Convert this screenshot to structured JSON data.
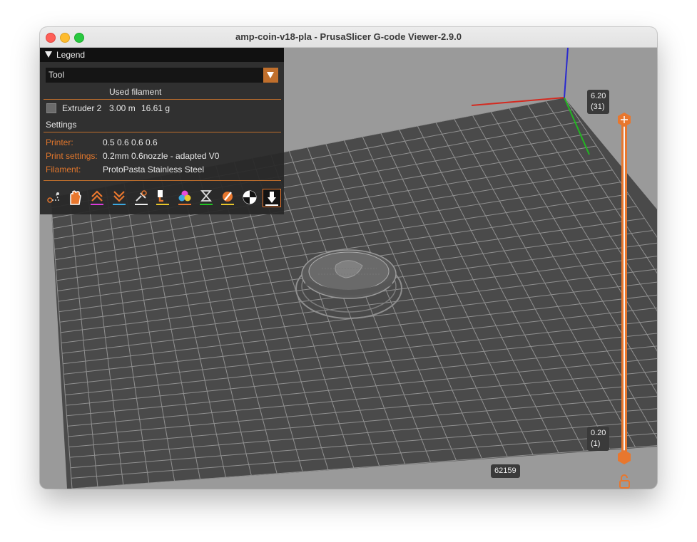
{
  "window": {
    "title": "amp-coin-v18-pla - PrusaSlicer G-code Viewer-2.9.0"
  },
  "legend": {
    "header": "Legend",
    "view_type_selected": "Tool",
    "column_header": "Used filament",
    "extruder": {
      "name": "Extruder 2",
      "length": "3.00 m",
      "weight": "16.61 g",
      "color": "#6b6b6b"
    },
    "settings_title": "Settings",
    "settings": [
      {
        "key": "Printer:",
        "value": "0.5 0.6 0.6 0.6"
      },
      {
        "key": "Print settings:",
        "value": "0.2mm 0.6nozzle - adapted V0"
      },
      {
        "key": "Filament:",
        "value": "ProtoPasta Stainless Steel"
      }
    ],
    "toolbar_icons": [
      "travel-icon",
      "retractions-icon",
      "deretractions-icon",
      "seams-icon",
      "tool-changes-icon",
      "color-changes-icon",
      "pause-prints-icon",
      "custom-gcode-icon",
      "center-of-gravity-icon",
      "shells-icon",
      "tool-marker-icon"
    ]
  },
  "vertical_slider": {
    "top": {
      "height": "6.20",
      "layer": "(31)"
    },
    "bottom": {
      "height": "0.20",
      "layer": "(1)"
    }
  },
  "horizontal_slider": {
    "value": "62159"
  },
  "colors": {
    "accent": "#e8772e",
    "legend_bg": "#2b2b2b",
    "bed": "#4a4a4a",
    "grid": "#9c9c9c"
  }
}
